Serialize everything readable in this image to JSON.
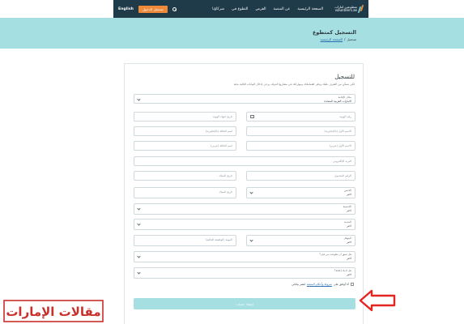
{
  "header": {
    "logo_lines": [
      "متطوعين.امارات",
      "volunteers.ae"
    ],
    "nav": [
      "الصفحة الرئيسية",
      "عن المنصة",
      "الفرص",
      "التطوع في",
      "شركاؤنا"
    ],
    "login_label": "تسجيل الدخول",
    "lang_label": "English"
  },
  "banner": {
    "title": "التسجيل كمتطوع",
    "breadcrumb_home": "الصفحة الرئيسية",
    "breadcrumb_current": "تسجيل"
  },
  "form": {
    "title": "للتسجيل",
    "subtitle": "لكي نتمكن من التعرف عليك وعلى اهتماماتك ومهاراتك في مشاريع الدولة، يرجى إدخال البيانات التالية بدقة",
    "emirate": {
      "label": "مكان الإقامة",
      "value": "الامارات العربية المتحدة"
    },
    "id_number": "رقم الهوية",
    "id_expiry": "تاريخ انتهاء الهوية",
    "first_name_en": "الاسم الأول (بالإنجليزية)",
    "last_name_en": "اسم العائلة (بالإنجليزية)",
    "first_name_ar": "الاسم الأول (عربي)",
    "last_name_ar": "اسم العائلة (عربي)",
    "email": "البريد الإلكتروني",
    "phone": "الرقم المحمول",
    "birth_date": "تاريخ الميلاد",
    "gender": {
      "label": "الجنس",
      "value": "اختر"
    },
    "nationality": {
      "label": "الجنسية",
      "value": "اختر"
    },
    "city": {
      "label": "المدينة",
      "value": "اختر"
    },
    "education": {
      "label": "المؤهل",
      "value": "اختر"
    },
    "occupation": "المهنة (الوظيفة الحالية)",
    "volunteered_before": {
      "label": "هل سبق أن تطوعت من قبل؟",
      "value": "اختر"
    },
    "disability": {
      "label": "هل لديك إعاقة؟",
      "value": "اختر"
    },
    "terms_prefix": "أنا أوافق على",
    "terms_link": "شروط وأحكام المنصة",
    "terms_suffix": "لنشر بياناتي",
    "submit_label": "إنشاء حساب"
  },
  "watermark": {
    "text": "مقالات الإمارات"
  }
}
